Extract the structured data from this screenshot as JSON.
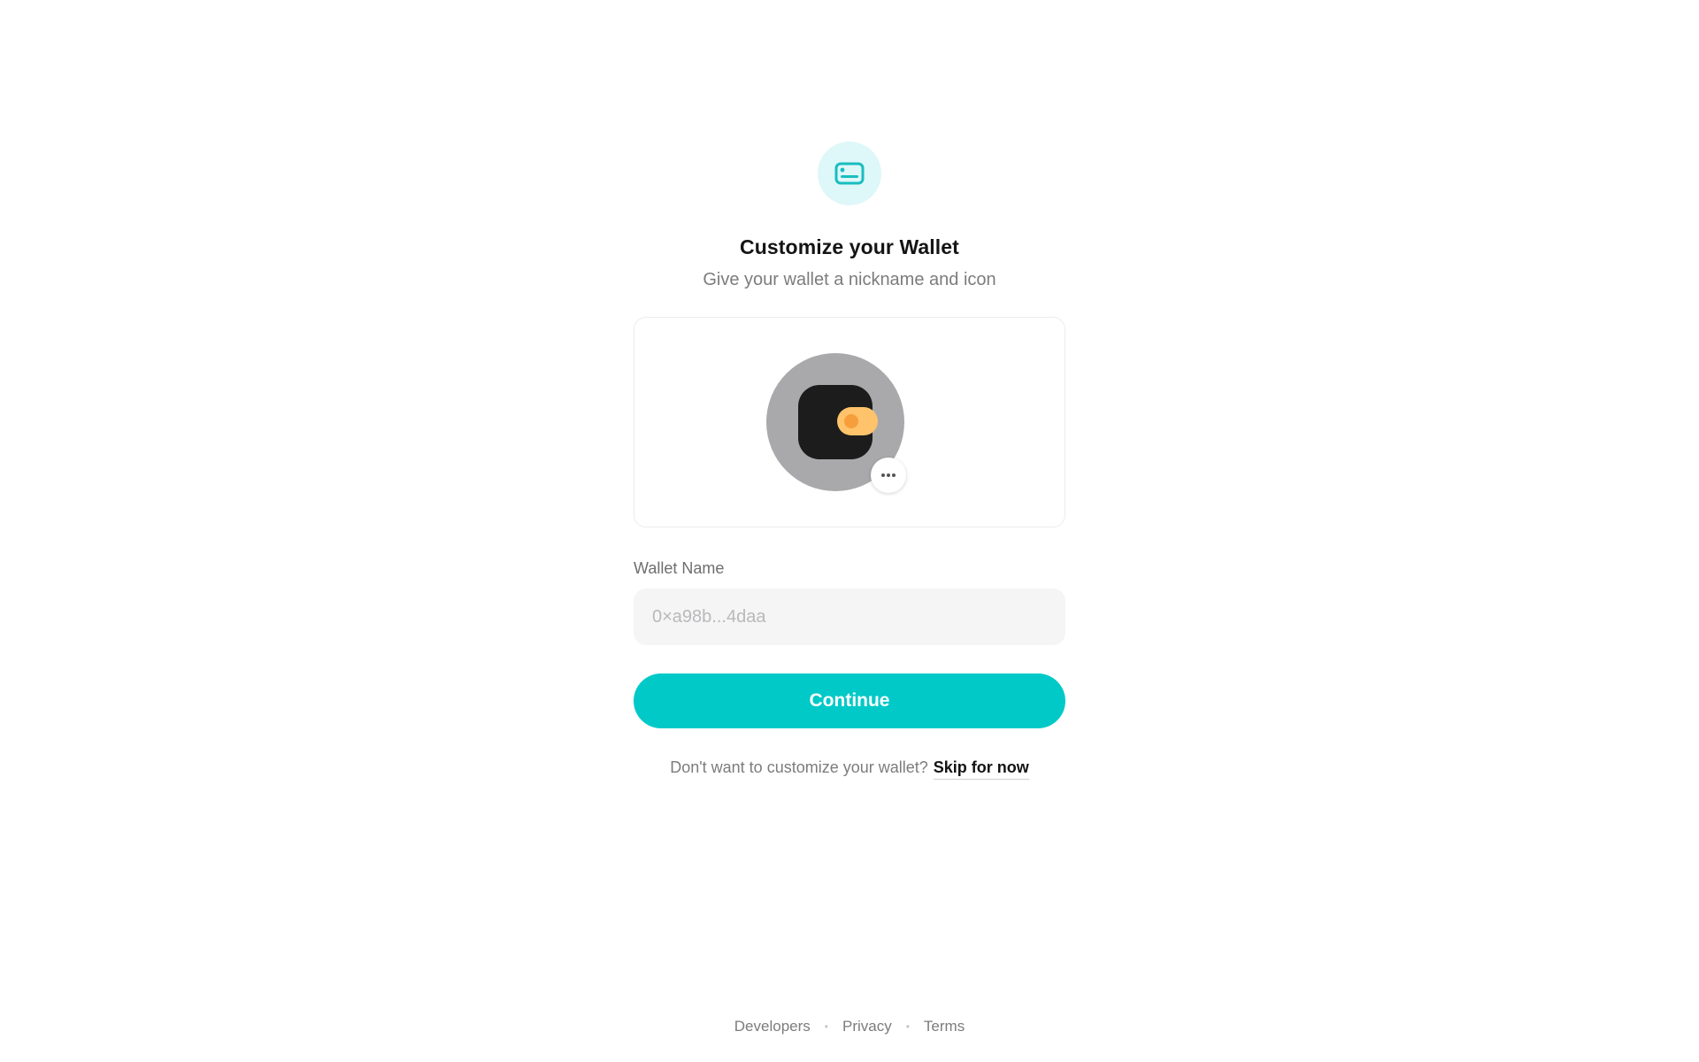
{
  "header": {
    "icon": "card-icon",
    "title": "Customize your Wallet",
    "subtitle": "Give your wallet a nickname and icon"
  },
  "icon_picker": {
    "icon": "wallet-icon",
    "more_icon": "more-horizontal-icon"
  },
  "form": {
    "wallet_name_label": "Wallet Name",
    "wallet_name_value": "",
    "wallet_name_placeholder": "0×a98b...4daa",
    "continue_label": "Continue"
  },
  "skip": {
    "prompt": "Don't want to customize your wallet?",
    "link_label": "Skip for now"
  },
  "footer": {
    "links": [
      "Developers",
      "Privacy",
      "Terms"
    ]
  },
  "colors": {
    "accent": "#00c9c8",
    "badge_bg": "#def7f8",
    "avatar_bg": "#a9a9ab",
    "wallet_body": "#1c1c1c",
    "wallet_clasp": "#ffc36b",
    "wallet_dot": "#f59e3b"
  }
}
